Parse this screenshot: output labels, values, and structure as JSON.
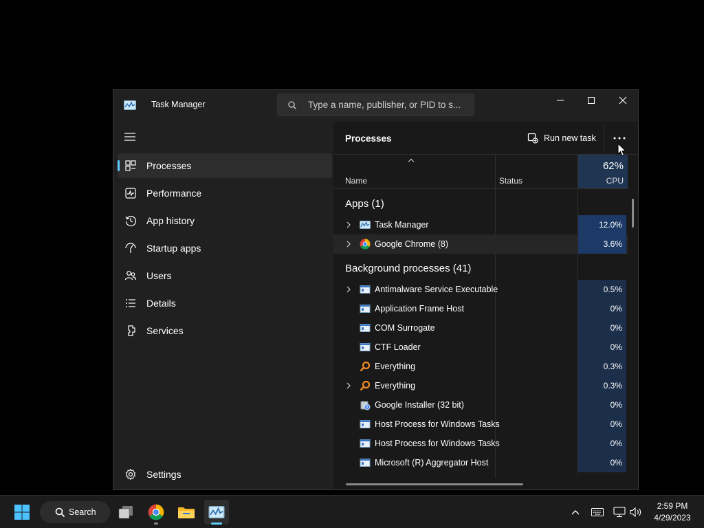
{
  "window": {
    "title": "Task Manager",
    "search_placeholder": "Type a name, publisher, or PID to s..."
  },
  "sidebar": {
    "items": [
      {
        "label": "Processes",
        "icon": "processes-icon",
        "active": true
      },
      {
        "label": "Performance",
        "icon": "performance-icon"
      },
      {
        "label": "App history",
        "icon": "history-icon"
      },
      {
        "label": "Startup apps",
        "icon": "startup-icon"
      },
      {
        "label": "Users",
        "icon": "users-icon"
      },
      {
        "label": "Details",
        "icon": "details-icon"
      },
      {
        "label": "Services",
        "icon": "services-icon"
      }
    ],
    "settings_label": "Settings"
  },
  "main": {
    "title": "Processes",
    "run_new_task_label": "Run new task",
    "columns": {
      "name": "Name",
      "status": "Status",
      "cpu_percent": "62%",
      "cpu": "CPU"
    },
    "apps_group": "Apps (1)",
    "apps": [
      {
        "name": "Task Manager",
        "cpu": "12.0%",
        "expandable": true,
        "icon": "task-manager-icon"
      },
      {
        "name": "Google Chrome (8)",
        "cpu": "3.6%",
        "expandable": true,
        "icon": "chrome-icon"
      }
    ],
    "background_group": "Background processes (41)",
    "background": [
      {
        "name": "Antimalware Service Executable",
        "cpu": "0.5%",
        "expandable": true,
        "icon": "service-window-icon"
      },
      {
        "name": "Application Frame Host",
        "cpu": "0%",
        "expandable": false,
        "icon": "service-window-icon"
      },
      {
        "name": "COM Surrogate",
        "cpu": "0%",
        "expandable": false,
        "icon": "service-window-icon"
      },
      {
        "name": "CTF Loader",
        "cpu": "0%",
        "expandable": false,
        "icon": "service-window-icon"
      },
      {
        "name": "Everything",
        "cpu": "0.3%",
        "expandable": false,
        "icon": "everything-search-icon"
      },
      {
        "name": "Everything",
        "cpu": "0.3%",
        "expandable": true,
        "icon": "everything-search-icon"
      },
      {
        "name": "Google Installer (32 bit)",
        "cpu": "0%",
        "expandable": false,
        "icon": "installer-icon"
      },
      {
        "name": "Host Process for Windows Tasks",
        "cpu": "0%",
        "expandable": false,
        "icon": "service-window-icon"
      },
      {
        "name": "Host Process for Windows Tasks",
        "cpu": "0%",
        "expandable": false,
        "icon": "service-window-icon"
      },
      {
        "name": "Microsoft (R) Aggregator Host",
        "cpu": "0%",
        "expandable": false,
        "icon": "service-window-icon"
      }
    ]
  },
  "taskbar": {
    "search_label": "Search",
    "time": "2:59 PM",
    "date": "4/29/2023"
  },
  "colors": {
    "accent": "#60cdff",
    "cpu_column_bg": "#1f3552",
    "cpu_cell_bg": "#1d3a66"
  }
}
